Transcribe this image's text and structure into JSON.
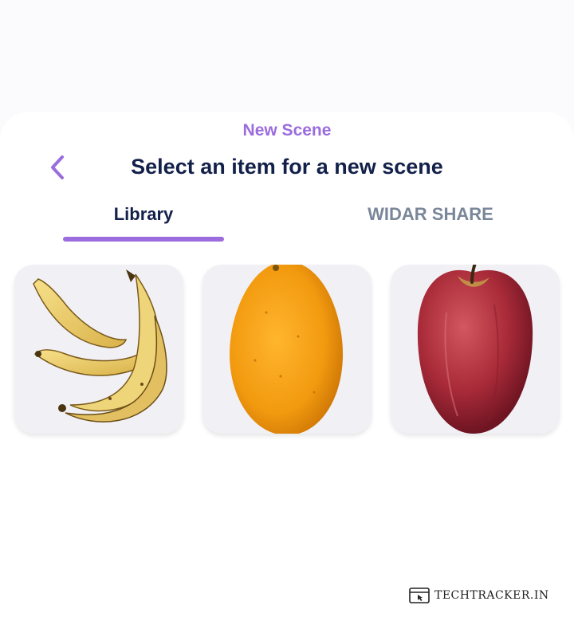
{
  "sheet": {
    "header_label": "New Scene",
    "title": "Select an item for a new scene"
  },
  "tabs": [
    {
      "label": "Library",
      "selected": true
    },
    {
      "label": "WIDAR SHARE",
      "selected": false
    }
  ],
  "items": [
    {
      "name": "banana",
      "image": "banana-bunch"
    },
    {
      "name": "orange",
      "image": "orange-fruit"
    },
    {
      "name": "apple",
      "image": "red-apple"
    }
  ],
  "colors": {
    "accent": "#9b6cde",
    "title": "#12204a",
    "inactive_tab": "#7a8699",
    "card_bg": "#f1f0f5"
  },
  "watermark": {
    "text": "TECHTRACKER.IN"
  }
}
